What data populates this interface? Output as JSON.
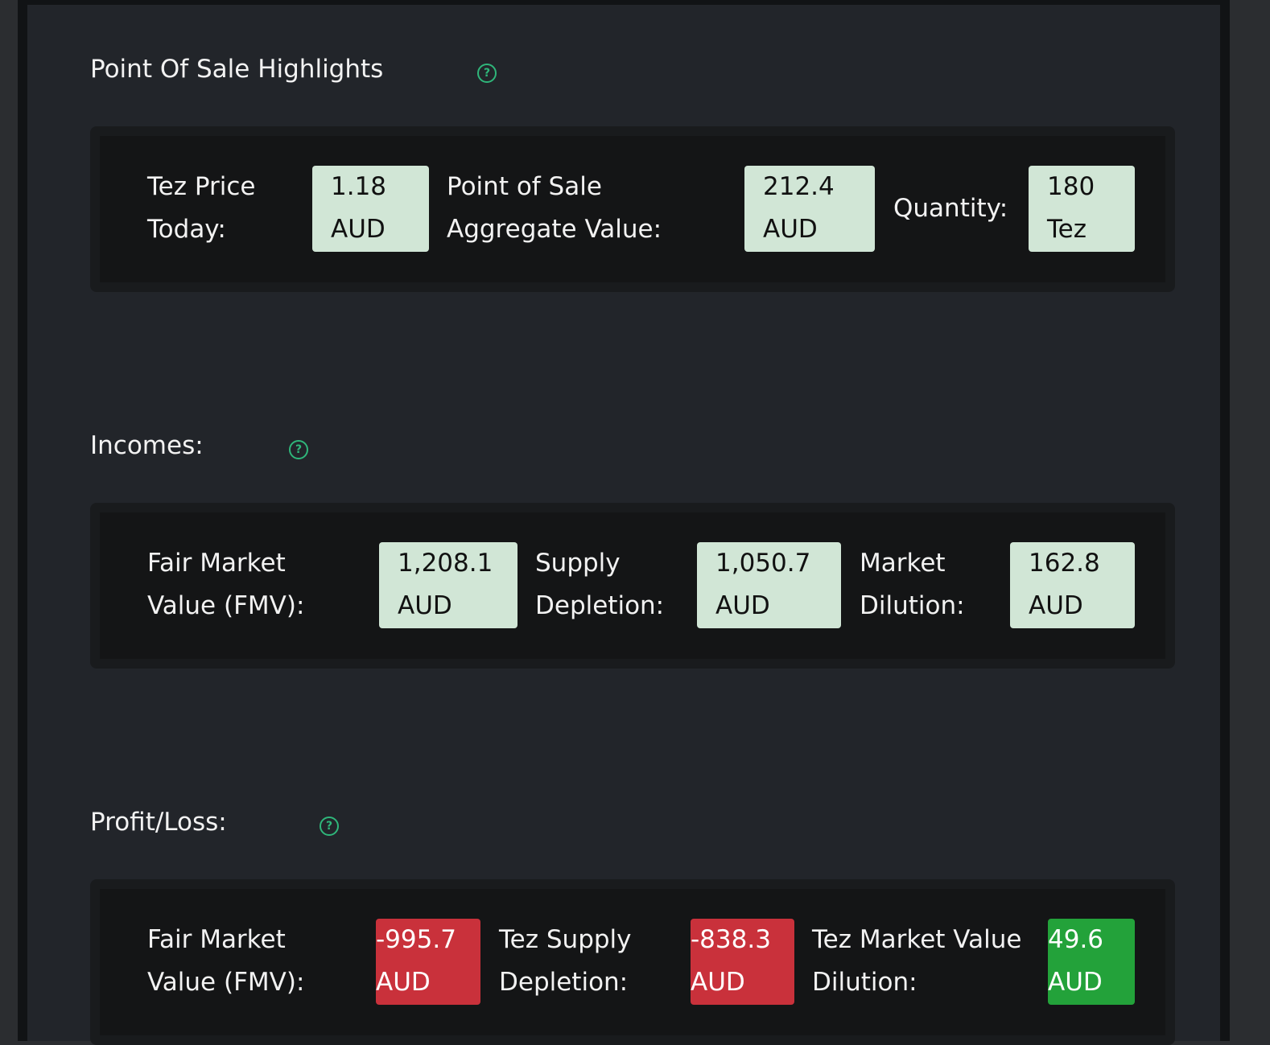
{
  "highlights": {
    "title": "Point Of Sale Highlights",
    "help_icon": "question-circle-icon",
    "tez_price_label_1": "Tez Price",
    "tez_price_label_2": "Today:",
    "tez_price_value": "1.18",
    "tez_price_unit": "AUD",
    "pos_value_label_1": "Point of Sale",
    "pos_value_label_2": "Aggregate Value:",
    "pos_value_value": "212.4",
    "pos_value_unit": "AUD",
    "quantity_label": "Quantity:",
    "quantity_value": "180",
    "quantity_unit": "Tez"
  },
  "incomes": {
    "title": "Incomes:",
    "help_icon": "question-circle-icon",
    "fmv_label_1": "Fair Market",
    "fmv_label_2": "Value (FMV):",
    "fmv_value": "1,208.1",
    "fmv_unit": "AUD",
    "supply_label_1": "Supply",
    "supply_label_2": "Depletion:",
    "supply_value": "1,050.7",
    "supply_unit": "AUD",
    "dilution_label_1": "Market",
    "dilution_label_2": "Dilution:",
    "dilution_value": "162.8",
    "dilution_unit": "AUD"
  },
  "profit_loss": {
    "title": "Profit/Loss:",
    "help_icon": "question-circle-icon",
    "fmv_label_1": "Fair Market",
    "fmv_label_2": "Value (FMV):",
    "fmv_value": "-995.7",
    "fmv_unit": "AUD",
    "supply_label_1": "Tez Supply",
    "supply_label_2": "Depletion:",
    "supply_value": "-838.3",
    "supply_unit": "AUD",
    "dilution_label_1": "Tez Market Value",
    "dilution_label_2": "Dilution:",
    "dilution_value": "49.6",
    "dilution_unit": "AUD"
  },
  "colors": {
    "neutral_value_bg": "#d1e6d6",
    "negative_value_bg": "#c9313b",
    "positive_value_bg": "#23a23a",
    "help_icon": "#2fb67a"
  }
}
